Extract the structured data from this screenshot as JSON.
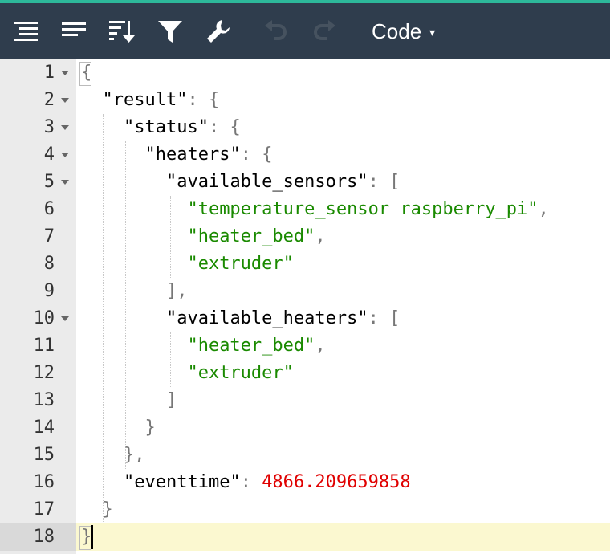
{
  "toolbar": {
    "icons": [
      "format-icon",
      "compact-icon",
      "sort-icon",
      "filter-icon",
      "repair-icon",
      "undo-icon",
      "redo-icon"
    ],
    "mode_label": "Code",
    "mode_caret": "▾"
  },
  "colors": {
    "toolbar_bg": "#2f3d4d",
    "accent": "#2db89a",
    "string": "#1a8a00",
    "number": "#e00000",
    "active_line": "#fbf8d0"
  },
  "editor": {
    "lines": [
      {
        "num": "1",
        "fold": true
      },
      {
        "num": "2",
        "fold": true
      },
      {
        "num": "3",
        "fold": true
      },
      {
        "num": "4",
        "fold": true
      },
      {
        "num": "5",
        "fold": true
      },
      {
        "num": "6",
        "fold": false
      },
      {
        "num": "7",
        "fold": false
      },
      {
        "num": "8",
        "fold": false
      },
      {
        "num": "9",
        "fold": false
      },
      {
        "num": "10",
        "fold": true
      },
      {
        "num": "11",
        "fold": false
      },
      {
        "num": "12",
        "fold": false
      },
      {
        "num": "13",
        "fold": false
      },
      {
        "num": "14",
        "fold": false
      },
      {
        "num": "15",
        "fold": false
      },
      {
        "num": "16",
        "fold": false
      },
      {
        "num": "17",
        "fold": false
      },
      {
        "num": "18",
        "fold": false
      }
    ],
    "tokens": {
      "l1_open": "{",
      "result_key": "\"result\"",
      "status_key": "\"status\"",
      "heaters_key": "\"heaters\"",
      "available_sensors_key": "\"available_sensors\"",
      "sensor_1": "\"temperature_sensor raspberry_pi\"",
      "sensor_2": "\"heater_bed\"",
      "sensor_3": "\"extruder\"",
      "available_heaters_key": "\"available_heaters\"",
      "heater_1": "\"heater_bed\"",
      "heater_2": "\"extruder\"",
      "eventtime_key": "\"eventtime\"",
      "eventtime_value": "4866.209659858",
      "l18_close": "}"
    }
  }
}
